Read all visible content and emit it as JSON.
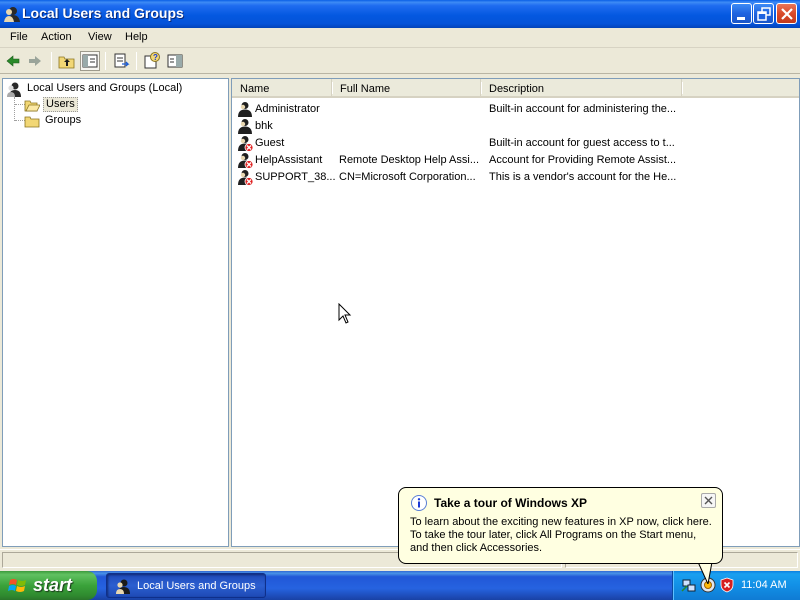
{
  "window": {
    "title": "Local Users and Groups",
    "icon": "users-groups-icon"
  },
  "menu": [
    "File",
    "Action",
    "View",
    "Help"
  ],
  "toolbar": {
    "buttons": [
      "back-arrow-icon",
      "forward-arrow-icon",
      "up-folder-icon",
      "show-hide-tree-icon",
      "export-list-icon",
      "help-icon",
      "show-hide-action-pane-icon"
    ]
  },
  "tree": {
    "root": "Local Users and Groups (Local)",
    "children": [
      "Users",
      "Groups"
    ],
    "selected": "Users"
  },
  "list": {
    "columns": [
      "Name",
      "Full Name",
      "Description"
    ],
    "rows": [
      {
        "name": "Administrator",
        "full_name": "",
        "description": "Built-in account for administering the...",
        "disabled": false
      },
      {
        "name": "bhk",
        "full_name": "",
        "description": "",
        "disabled": false
      },
      {
        "name": "Guest",
        "full_name": "",
        "description": "Built-in account for guest access to t...",
        "disabled": true
      },
      {
        "name": "HelpAssistant",
        "full_name": "Remote Desktop Help Assi...",
        "description": "Account for Providing Remote Assist...",
        "disabled": true
      },
      {
        "name": "SUPPORT_38...",
        "full_name": "CN=Microsoft Corporation...",
        "description": "This is a vendor's account for the He...",
        "disabled": true
      }
    ]
  },
  "balloon": {
    "title": "Take a tour of Windows XP",
    "lines": [
      "To learn about the exciting new features in XP now, click here.",
      "To take the tour later, click All Programs on the Start menu,",
      "and then click Accessories."
    ]
  },
  "taskbar": {
    "start_label": "start",
    "task_label": "Local Users and Groups",
    "clock": "11:04 AM",
    "tray_icons": [
      "network-icon",
      "tour-icon",
      "security-alert-icon"
    ]
  },
  "colors": {
    "titlebar": "#0458e0",
    "taskbar": "#2663e0",
    "start": "#3aa23a",
    "balloon": "#ffffe1"
  }
}
